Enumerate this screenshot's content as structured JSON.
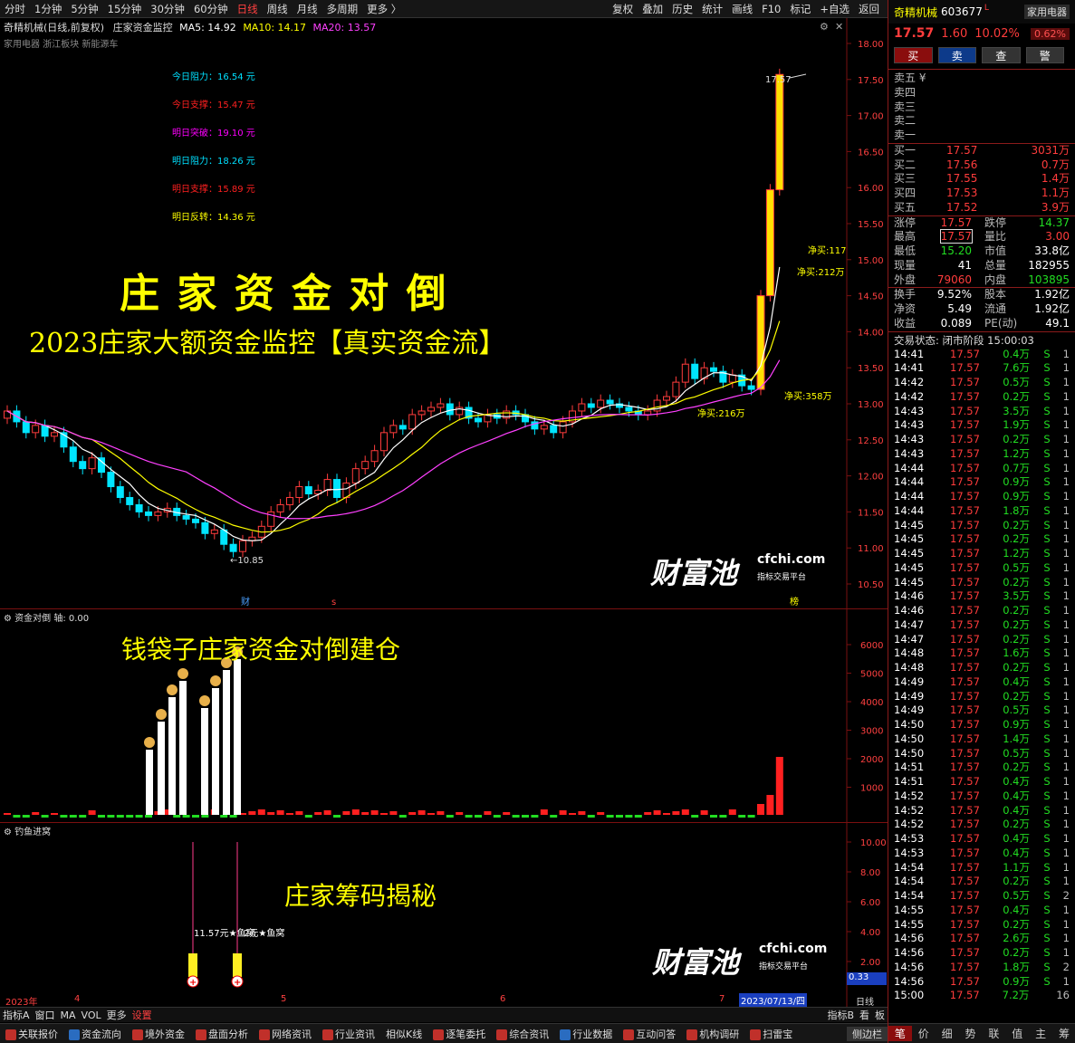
{
  "toolbar": {
    "left": [
      "分时",
      "1分钟",
      "5分钟",
      "15分钟",
      "30分钟",
      "60分钟",
      "日线",
      "周线",
      "月线",
      "多周期",
      "更多 〉"
    ],
    "active": "日线",
    "right": [
      "复权",
      "叠加",
      "历史",
      "统计",
      "画线",
      "F10",
      "标记",
      "+自选",
      "返回"
    ]
  },
  "chart_header": {
    "title": "奇精机械(日线,前复权)",
    "indicator": "庄家资金监控",
    "ma5": "MA5: 14.92",
    "ma10": "MA10: 14.17",
    "ma20": "MA20: 13.57",
    "tags": "家用电器 浙江板块 新能源车"
  },
  "levels": [
    {
      "text": "今日阻力：16.54 元",
      "color": "#00e0ff"
    },
    {
      "text": "今日支撑：15.47 元",
      "color": "#ff2020"
    },
    {
      "text": "明日突破：19.10 元",
      "color": "#ff00ff"
    },
    {
      "text": "明日阻力：18.26 元",
      "color": "#00e0ff"
    },
    {
      "text": "明日支撑：15.89 元",
      "color": "#ff2020"
    },
    {
      "text": "明日反转：14.36 元",
      "color": "#ffff00"
    }
  ],
  "overlays": {
    "headline": "庄 家 资 金 对 倒",
    "subline": "2023庄家大额资金监控【真实资金流】",
    "panel2_text": "钱袋子庄家资金对倒建仓",
    "panel3_text": "庄家筹码揭秘",
    "watermark_cn": "财富池",
    "watermark_url": "cfchi.com",
    "watermark_sub": "指标交易平台"
  },
  "annotations": {
    "high": "17.57",
    "low": "←10.85",
    "net1": "净买:216万",
    "net2": "净买:358万",
    "net3": "净买:212万",
    "net4": "净买:117",
    "mark_cai": "财",
    "mark_s": "s",
    "mark_bang": "榜"
  },
  "price_axis": [
    "18.00",
    "17.50",
    "17.00",
    "16.50",
    "16.00",
    "15.50",
    "15.00",
    "14.50",
    "14.00",
    "13.50",
    "13.00",
    "12.50",
    "12.00",
    "11.50",
    "11.00",
    "10.50"
  ],
  "panel2": {
    "title": "资金对倒",
    "axis": "轴: 0.00",
    "ticks": [
      "6000",
      "5000",
      "4000",
      "3000",
      "2000",
      "1000"
    ]
  },
  "panel3": {
    "title": "钓鱼进窝",
    "ticks": [
      "10.00",
      "8.00",
      "6.00",
      "4.00",
      "2.00"
    ],
    "label": "11.57元★鱼窝",
    "label2": "2元★鱼窝",
    "value": "0.33"
  },
  "time_axis": {
    "labels": [
      "2023年",
      "4",
      "5",
      "6",
      "7"
    ],
    "date": "2023/07/13/四",
    "period": "日线"
  },
  "tabs1": [
    "指标A",
    "窗口",
    "MA",
    "VOL",
    "更多",
    "设置"
  ],
  "tabs1_right": [
    "指标B",
    "看",
    "板"
  ],
  "tabs2": [
    "关联报价",
    "资金流向",
    "境外资金",
    "盘面分析",
    "网络资讯",
    "行业资讯",
    "相似K线",
    "逐笔委托",
    "综合资讯",
    "行业数据",
    "互动问答",
    "机构调研",
    "扫雷宝"
  ],
  "tabs2_right": "侧边栏",
  "stock": {
    "name": "奇精机械",
    "code": "603677",
    "flag": "L",
    "sector": "家用电器",
    "price": "17.57",
    "change": "1.60",
    "pct": "10.02%",
    "sector_pct": "0.62%"
  },
  "trade_buttons": [
    "买",
    "卖",
    "查",
    "警"
  ],
  "asks": [
    "卖五 ¥",
    "卖四",
    "卖三",
    "卖二",
    "卖一"
  ],
  "bids": [
    {
      "label": "买一",
      "price": "17.57",
      "vol": "3031万"
    },
    {
      "label": "买二",
      "price": "17.56",
      "vol": "0.7万"
    },
    {
      "label": "买三",
      "price": "17.55",
      "vol": "1.4万"
    },
    {
      "label": "买四",
      "price": "17.53",
      "vol": "1.1万"
    },
    {
      "label": "买五",
      "price": "17.52",
      "vol": "3.9万"
    }
  ],
  "stats": [
    {
      "l1": "涨停",
      "v1": "17.57",
      "c1": "red",
      "l2": "跌停",
      "v2": "14.37",
      "c2": "grn"
    },
    {
      "l1": "最高",
      "v1": "17.57",
      "c1": "red",
      "l2": "量比",
      "v2": "3.00",
      "c2": "red"
    },
    {
      "l1": "最低",
      "v1": "15.20",
      "c1": "grn",
      "l2": "市值",
      "v2": "33.8亿",
      "c2": "wht"
    },
    {
      "l1": "现量",
      "v1": "41",
      "c1": "wht",
      "l2": "总量",
      "v2": "182955",
      "c2": "wht"
    },
    {
      "l1": "外盘",
      "v1": "79060",
      "c1": "red",
      "l2": "内盘",
      "v2": "103895",
      "c2": "grn"
    }
  ],
  "stats2": [
    {
      "l1": "换手",
      "v1": "9.52%",
      "l2": "股本",
      "v2": "1.92亿"
    },
    {
      "l1": "净资",
      "v1": "5.49",
      "l2": "流通",
      "v2": "1.92亿"
    },
    {
      "l1": "收益",
      "v1": "0.089",
      "l2": "PE(动)",
      "v2": "49.1"
    }
  ],
  "trade_status": "交易状态: 闭市阶段 15:00:03",
  "ticks": [
    [
      "14:41",
      "17.57",
      "0.4万",
      "S",
      "1"
    ],
    [
      "14:41",
      "17.57",
      "7.6万",
      "S",
      "1"
    ],
    [
      "14:42",
      "17.57",
      "0.5万",
      "S",
      "1"
    ],
    [
      "14:42",
      "17.57",
      "0.2万",
      "S",
      "1"
    ],
    [
      "14:43",
      "17.57",
      "3.5万",
      "S",
      "1"
    ],
    [
      "14:43",
      "17.57",
      "1.9万",
      "S",
      "1"
    ],
    [
      "14:43",
      "17.57",
      "0.2万",
      "S",
      "1"
    ],
    [
      "14:43",
      "17.57",
      "1.2万",
      "S",
      "1"
    ],
    [
      "14:44",
      "17.57",
      "0.7万",
      "S",
      "1"
    ],
    [
      "14:44",
      "17.57",
      "0.9万",
      "S",
      "1"
    ],
    [
      "14:44",
      "17.57",
      "0.9万",
      "S",
      "1"
    ],
    [
      "14:44",
      "17.57",
      "1.8万",
      "S",
      "1"
    ],
    [
      "14:45",
      "17.57",
      "0.2万",
      "S",
      "1"
    ],
    [
      "14:45",
      "17.57",
      "0.2万",
      "S",
      "1"
    ],
    [
      "14:45",
      "17.57",
      "1.2万",
      "S",
      "1"
    ],
    [
      "14:45",
      "17.57",
      "0.5万",
      "S",
      "1"
    ],
    [
      "14:45",
      "17.57",
      "0.2万",
      "S",
      "1"
    ],
    [
      "14:46",
      "17.57",
      "3.5万",
      "S",
      "1"
    ],
    [
      "14:46",
      "17.57",
      "0.2万",
      "S",
      "1"
    ],
    [
      "14:47",
      "17.57",
      "0.2万",
      "S",
      "1"
    ],
    [
      "14:47",
      "17.57",
      "0.2万",
      "S",
      "1"
    ],
    [
      "14:48",
      "17.57",
      "1.6万",
      "S",
      "1"
    ],
    [
      "14:48",
      "17.57",
      "0.2万",
      "S",
      "1"
    ],
    [
      "14:49",
      "17.57",
      "0.4万",
      "S",
      "1"
    ],
    [
      "14:49",
      "17.57",
      "0.2万",
      "S",
      "1"
    ],
    [
      "14:49",
      "17.57",
      "0.5万",
      "S",
      "1"
    ],
    [
      "14:50",
      "17.57",
      "0.9万",
      "S",
      "1"
    ],
    [
      "14:50",
      "17.57",
      "1.4万",
      "S",
      "1"
    ],
    [
      "14:50",
      "17.57",
      "0.5万",
      "S",
      "1"
    ],
    [
      "14:51",
      "17.57",
      "0.2万",
      "S",
      "1"
    ],
    [
      "14:51",
      "17.57",
      "0.4万",
      "S",
      "1"
    ],
    [
      "14:52",
      "17.57",
      "0.4万",
      "S",
      "1"
    ],
    [
      "14:52",
      "17.57",
      "0.4万",
      "S",
      "1"
    ],
    [
      "14:52",
      "17.57",
      "0.2万",
      "S",
      "1"
    ],
    [
      "14:53",
      "17.57",
      "0.4万",
      "S",
      "1"
    ],
    [
      "14:53",
      "17.57",
      "0.4万",
      "S",
      "1"
    ],
    [
      "14:54",
      "17.57",
      "1.1万",
      "S",
      "1"
    ],
    [
      "14:54",
      "17.57",
      "0.2万",
      "S",
      "1"
    ],
    [
      "14:54",
      "17.57",
      "0.5万",
      "S",
      "2"
    ],
    [
      "14:55",
      "17.57",
      "0.4万",
      "S",
      "1"
    ],
    [
      "14:55",
      "17.57",
      "0.2万",
      "S",
      "1"
    ],
    [
      "14:56",
      "17.57",
      "2.6万",
      "S",
      "1"
    ],
    [
      "14:56",
      "17.57",
      "0.2万",
      "S",
      "1"
    ],
    [
      "14:56",
      "17.57",
      "1.8万",
      "S",
      "2"
    ],
    [
      "14:56",
      "17.57",
      "0.9万",
      "S",
      "1"
    ],
    [
      "15:00",
      "17.57",
      "7.2万",
      "",
      "16"
    ]
  ],
  "right_tabs": [
    "笔",
    "价",
    "细",
    "势",
    "联",
    "值",
    "主",
    "筹"
  ]
}
